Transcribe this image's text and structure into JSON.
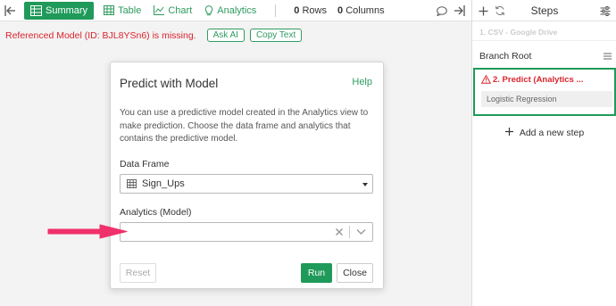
{
  "topbar": {
    "views": [
      {
        "label": "Summary",
        "icon": "summary-table-icon",
        "active": true
      },
      {
        "label": "Table",
        "icon": "table-grid-icon",
        "active": false
      },
      {
        "label": "Chart",
        "icon": "chart-icon",
        "active": false
      },
      {
        "label": "Analytics",
        "icon": "lightbulb-icon",
        "active": false
      }
    ],
    "rows_count": "0",
    "rows_label": "Rows",
    "columns_count": "0",
    "columns_label": "Columns"
  },
  "error": {
    "message": "Referenced Model (ID: BJL8YSn6) is missing.",
    "ask_ai_label": "Ask AI",
    "copy_text_label": "Copy Text"
  },
  "modal": {
    "title": "Predict with Model",
    "help_label": "Help",
    "description": "You can use a predictive model created in the Analytics view to make prediction. Choose the data frame and analytics that contains the predictive model.",
    "data_frame_label": "Data Frame",
    "data_frame_value": "Sign_Ups",
    "analytics_label": "Analytics (Model)",
    "analytics_value": "",
    "reset_label": "Reset",
    "run_label": "Run",
    "close_label": "Close"
  },
  "steps": {
    "title": "Steps",
    "step1_label": "1. CSV - Google Drive",
    "branch_root_label": "Branch Root",
    "step2_label": "2. Predict (Analytics ...",
    "step2_detail": "Logistic Regression",
    "add_step_label": "Add a new step"
  },
  "colors": {
    "accent_green": "#1f9a5a",
    "error_red": "#d9242c",
    "arrow_pink": "#f0306a"
  }
}
